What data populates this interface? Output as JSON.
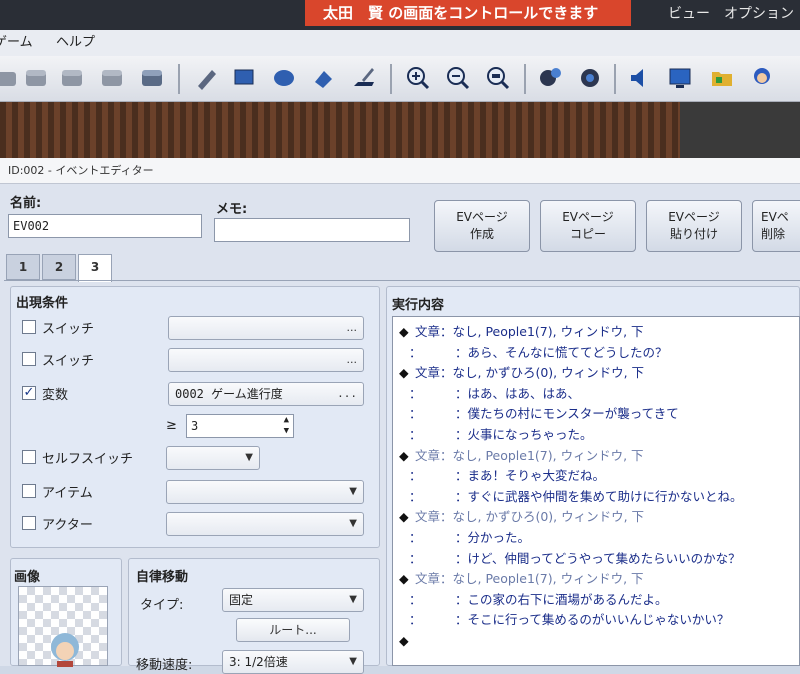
{
  "system": {
    "banner": "太田　賢 の画面をコントロールできます",
    "view_menu": "ビュー",
    "options_menu": "オプション"
  },
  "menubar": {
    "game": "ゲーム",
    "help": "ヘルプ"
  },
  "dialog": {
    "title": "ID:002 - イベントエディター"
  },
  "form": {
    "name_label": "名前:",
    "name_value": "EV002",
    "memo_label": "メモ:",
    "memo_value": ""
  },
  "buttons": {
    "create": "EVページ\n作成",
    "copy": "EVページ\nコピー",
    "paste": "EVページ\n貼り付け",
    "delete": "EVペ\n削除"
  },
  "tabs": [
    "1",
    "2",
    "3"
  ],
  "conditions": {
    "title": "出現条件",
    "switch1": "スイッチ",
    "switch2": "スイッチ",
    "variable": "変数",
    "variable_value": "0002 ゲーム進行度",
    "ge": "≥",
    "num": "3",
    "self_switch": "セルフスイッチ",
    "item": "アイテム",
    "actor": "アクター",
    "dots": "..."
  },
  "graphic": {
    "title": "画像"
  },
  "autonomous": {
    "title": "自律移動",
    "type_label": "タイプ:",
    "type_value": "固定",
    "route": "ルート...",
    "speed_label": "移動速度:",
    "speed_value": "3: 1/2倍速"
  },
  "exec": {
    "title": "実行内容",
    "lines": [
      {
        "kind": "cmd",
        "text": "文章：なし, People1(7), ウィンドウ, 下",
        "dim": false
      },
      {
        "kind": "cont",
        "text": "：あら、そんなに慌ててどうしたの？"
      },
      {
        "kind": "cmd",
        "text": "文章：なし, かずひろ(0), ウィンドウ, 下",
        "dim": false
      },
      {
        "kind": "cont",
        "text": "：はあ、はあ、はあ、"
      },
      {
        "kind": "cont",
        "text": "：僕たちの村にモンスターが襲ってきて"
      },
      {
        "kind": "cont",
        "text": "：火事になっちゃった。"
      },
      {
        "kind": "cmd",
        "text": "文章：なし, People1(7), ウィンドウ, 下",
        "dim": true
      },
      {
        "kind": "cont",
        "text": "：まあ！そりゃ大変だね。"
      },
      {
        "kind": "cont",
        "text": "：すぐに武器や仲間を集めて助けに行かないとね。"
      },
      {
        "kind": "cmd",
        "text": "文章：なし, かずひろ(0), ウィンドウ, 下",
        "dim": true
      },
      {
        "kind": "cont",
        "text": "：分かった。"
      },
      {
        "kind": "cont",
        "text": "：けど、仲間ってどうやって集めたらいいのかな？"
      },
      {
        "kind": "cmd",
        "text": "文章：なし, People1(7), ウィンドウ, 下",
        "dim": true
      },
      {
        "kind": "cont",
        "text": "：この家の右下に酒場があるんだよ。"
      },
      {
        "kind": "cont",
        "text": "：そこに行って集めるのがいいんじゃないかい？"
      },
      {
        "kind": "end",
        "text": ""
      }
    ]
  },
  "colors": {
    "banner": "#d9462c",
    "accent_text": "#1b2e8a"
  }
}
